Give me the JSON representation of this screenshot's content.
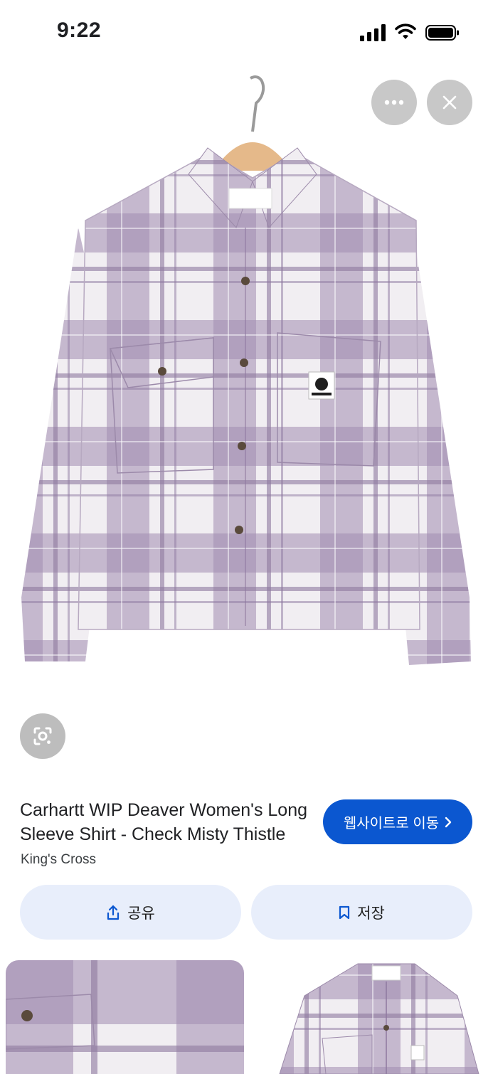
{
  "status_bar": {
    "time": "9:22"
  },
  "top_controls": {
    "more_icon": "more-horizontal-icon",
    "close_icon": "close-icon"
  },
  "lens": {
    "icon": "lens-icon"
  },
  "product": {
    "title": "Carhartt WIP Deaver Women's Long Sleeve Shirt - Check Misty Thistle",
    "source": "King's Cross"
  },
  "actions": {
    "visit_label": "웹사이트로 이동",
    "share_label": "공유",
    "save_label": "저장"
  },
  "colors": {
    "accent": "#0b57d0",
    "action_bg": "#e8eefb",
    "plaid_purple": "#a08cb0",
    "plaid_light": "#f1eef2"
  }
}
